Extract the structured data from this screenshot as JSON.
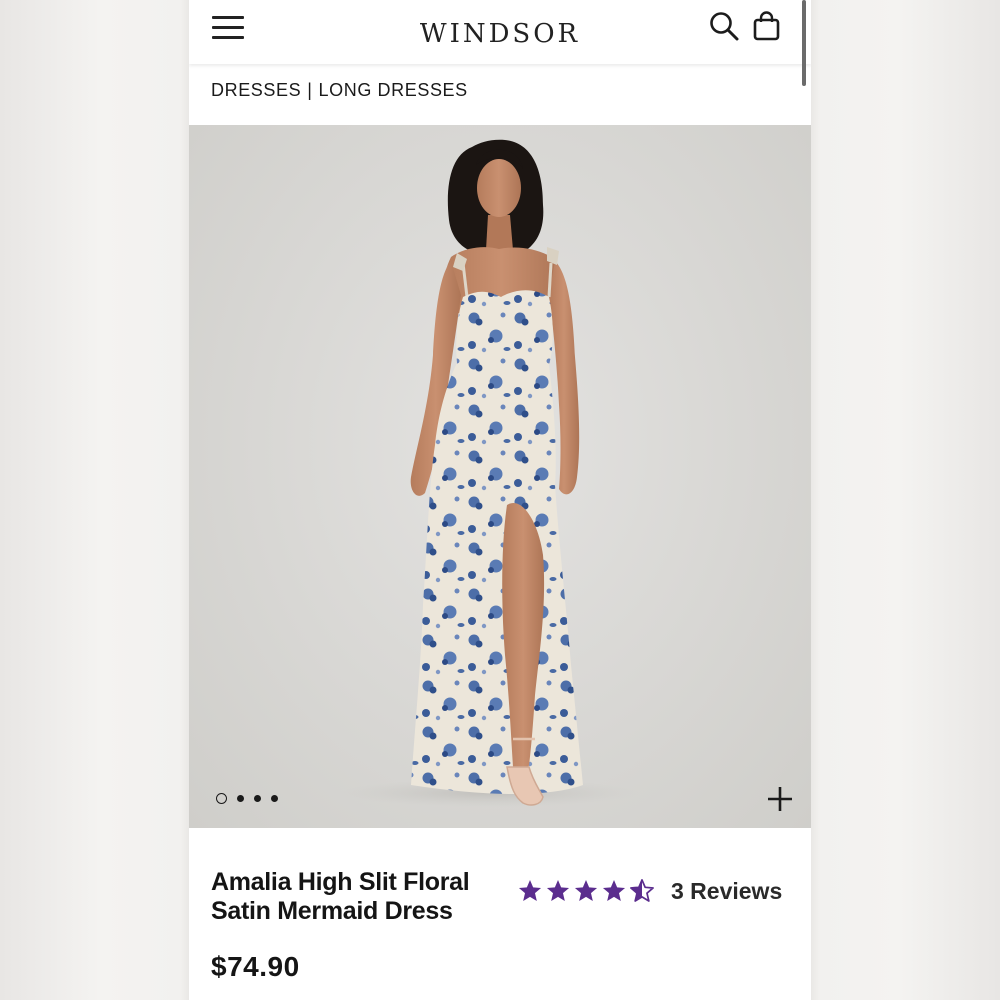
{
  "header": {
    "logo_text": "WINDSOR",
    "menu_icon": "hamburger-menu-icon",
    "search_icon": "search-icon",
    "bag_icon": "shopping-bag-icon"
  },
  "breadcrumb": {
    "items": [
      "DRESSES",
      "LONG DRESSES"
    ],
    "separator": "|"
  },
  "gallery": {
    "image_count": 4,
    "active_index": 0,
    "zoom_icon": "plus-icon"
  },
  "product": {
    "title": "Amalia High Slit Floral Satin Mermaid Dress",
    "rating_value": 4.5,
    "rating_max": 5,
    "reviews_label": "3 Reviews",
    "price": "$74.90"
  },
  "colors": {
    "star": "#5b2d8e",
    "text": "#151515"
  }
}
